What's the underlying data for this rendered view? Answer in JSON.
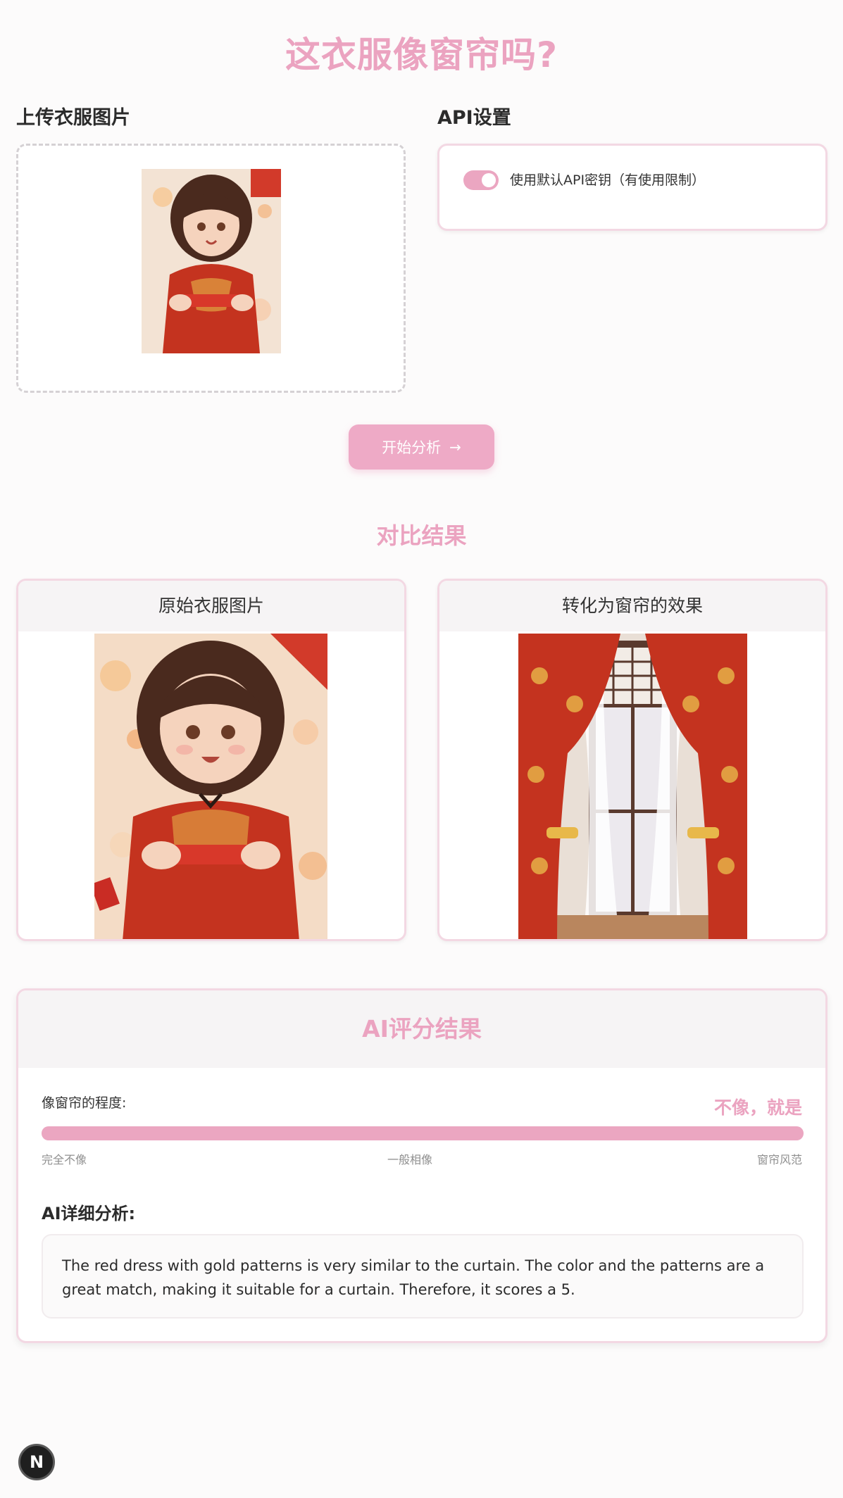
{
  "header": {
    "title": "这衣服像窗帘吗?"
  },
  "upload": {
    "heading": "上传衣服图片"
  },
  "api": {
    "heading": "API设置",
    "use_default_label": "使用默认API密钥（有使用限制）",
    "use_default_enabled": true
  },
  "actions": {
    "analyze_label": "开始分析",
    "arrow_icon": "→"
  },
  "comparison": {
    "title": "对比结果",
    "original_label": "原始衣服图片",
    "curtain_label": "转化为窗帘的效果"
  },
  "score": {
    "title": "AI评分结果",
    "degree_label": "像窗帘的程度:",
    "verdict": "不像，就是",
    "progress_fraction": 1.0,
    "scale_low": "完全不像",
    "scale_mid": "一般相像",
    "scale_high": "窗帘风范",
    "detail_title": "AI详细分析:",
    "detail_text": "The red dress with gold patterns is very similar to the curtain. The color and the patterns are a great match, making it suitable for a curtain. Therefore, it scores a 5."
  },
  "badge": {
    "letter": "N"
  },
  "colors": {
    "accent": "#eba3c0",
    "dress_red": "#c4331f",
    "gold": "#e8b84a"
  }
}
